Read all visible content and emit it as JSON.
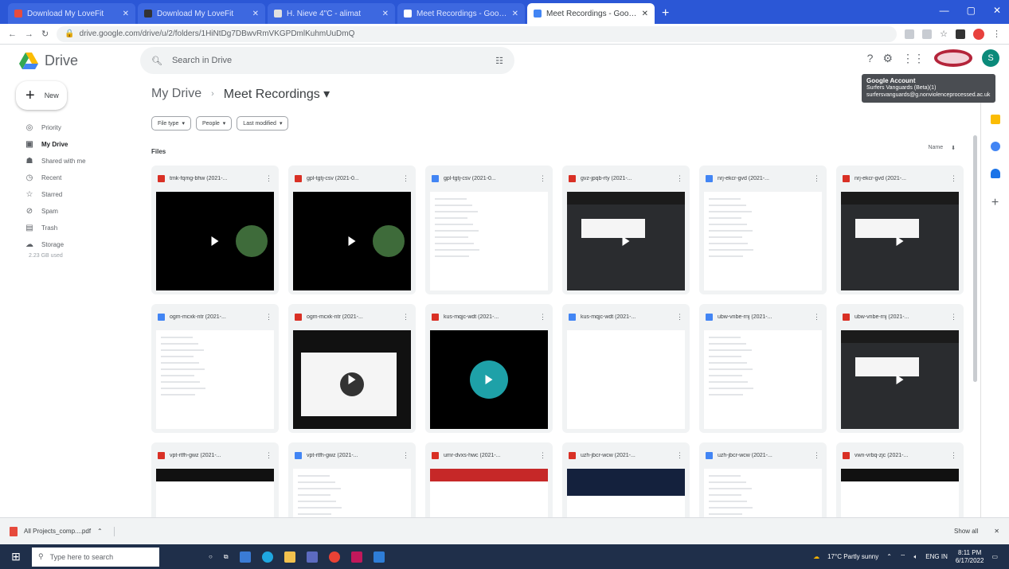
{
  "browser": {
    "tabs": [
      {
        "label": "Download My LoveFit",
        "color": "#e74c3c"
      },
      {
        "label": "Download My LoveFit",
        "color": "#333333"
      },
      {
        "label": "H. Nieve 4\"C - alimat",
        "color": "#e0e0e0"
      },
      {
        "label": "Meet Recordings - Google Drive",
        "color": "#ffffff"
      },
      {
        "label": "Meet Recordings - Google Drive",
        "color": "#4285f4"
      }
    ],
    "url": "drive.google.com/drive/u/2/folders/1HiNtDg7DBwvRmVKGPDmlKuhmUuDmQ",
    "window_controls": [
      "—",
      "▢",
      "✕"
    ]
  },
  "drive": {
    "app_title": "Drive",
    "search_placeholder": "Search in Drive",
    "account_avatar_letter": "S",
    "tooltip": {
      "title": "Google Account",
      "line1": "Surfers Vanguards (Beta)(1)",
      "line2": "surfersvanguards@g.nonviolenceprocessed.ac.uk"
    }
  },
  "sidebar": {
    "new_label": "New",
    "items": [
      {
        "label": "Priority",
        "icon": "priority-icon"
      },
      {
        "label": "My Drive",
        "icon": "my-drive-icon"
      },
      {
        "label": "Shared with me",
        "icon": "shared-icon"
      },
      {
        "label": "Recent",
        "icon": "recent-icon"
      },
      {
        "label": "Starred",
        "icon": "star-icon"
      },
      {
        "label": "Spam",
        "icon": "spam-icon"
      },
      {
        "label": "Trash",
        "icon": "trash-icon"
      },
      {
        "label": "Storage",
        "icon": "cloud-icon"
      }
    ],
    "storage_text": "2.23 GB used"
  },
  "main": {
    "breadcrumb_root": "My Drive",
    "breadcrumb_current": "Meet Recordings",
    "filters": [
      "File type",
      "People",
      "Last modified"
    ],
    "files_label": "Files",
    "sort_label": "Name",
    "files": [
      {
        "name": "tmk-fqmg-bhw (2021-...",
        "type": "video",
        "thumb": "face"
      },
      {
        "name": "gpl-tgtj-csv (2021-0...",
        "type": "video",
        "thumb": "face"
      },
      {
        "name": "gpl-tgtj-csv (2021-0...",
        "type": "doc",
        "thumb": "doc"
      },
      {
        "name": "gvz-jpqb-rty (2021-...",
        "type": "video",
        "thumb": "screen"
      },
      {
        "name": "nrj-ekcr-gvd (2021-...",
        "type": "doc",
        "thumb": "doc"
      },
      {
        "name": "nrj-ekcr-gvd (2021-...",
        "type": "video",
        "thumb": "screen"
      },
      {
        "name": "ogm-mcxk-ntr (2021-...",
        "type": "doc",
        "thumb": "doc"
      },
      {
        "name": "ogm-mcxk-ntr (2021-...",
        "type": "video",
        "thumb": "docplay"
      },
      {
        "name": "kus-mqjc-wdt (2021-...",
        "type": "video",
        "thumb": "teal"
      },
      {
        "name": "kus-mqjc-wdt (2021-...",
        "type": "doc",
        "thumb": "blank"
      },
      {
        "name": "ubw-vnbe-rnj (2021-...",
        "type": "doc",
        "thumb": "doc"
      },
      {
        "name": "ubw-vnbe-rnj (2021-...",
        "type": "video",
        "thumb": "screen"
      },
      {
        "name": "vpt-rtfh-gwz (2021-...",
        "type": "video",
        "thumb": "strip"
      },
      {
        "name": "vpt-rtfh-gwz (2021-...",
        "type": "doc",
        "thumb": "doc"
      },
      {
        "name": "umr-dvxs-hwc (2021-...",
        "type": "video",
        "thumb": "red"
      },
      {
        "name": "uzh-jbcr-wcw (2021-...",
        "type": "video",
        "thumb": "navy"
      },
      {
        "name": "uzh-jbcr-wcw (2021-...",
        "type": "doc",
        "thumb": "doc"
      },
      {
        "name": "vwn-vrbq-zjc (2021-...",
        "type": "video",
        "thumb": "strip"
      }
    ]
  },
  "download_bar": {
    "item": "All Projects_comp....pdf",
    "show_all": "Show all"
  },
  "taskbar": {
    "search_placeholder": "Type here to search",
    "weather": "17°C Partly sunny",
    "time": "8:11 PM",
    "date": "6/17/2022",
    "lang": "ENG IN"
  }
}
